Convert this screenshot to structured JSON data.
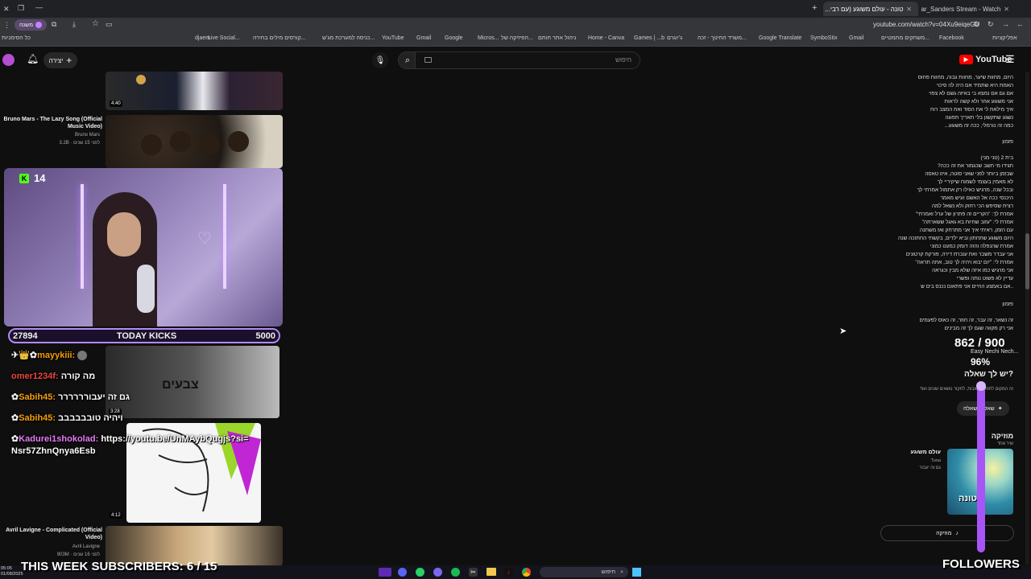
{
  "browser": {
    "tabs": [
      {
        "title": "טונה - עולם משוגע (עם רבי...",
        "active": true
      },
      {
        "title": "Hadar_Sanders Stream - Watch",
        "active": false
      }
    ],
    "url": "youtube.com/watch?v=04Xu9eiqeGU",
    "profile_label": "משנה",
    "bookmarks": [
      "כל הסימניות",
      "אפליקציות",
      "Facebook",
      "משחקים מתמטיים...",
      "Gmail",
      "SymboStix",
      "Google Translate",
      "משרד החינוך - זכה...",
      "ג'יוגרם",
      "Games | ...b",
      "Home - Canva",
      "ניהול אתר חותם",
      "הפיזיקה של...",
      "Micros...",
      "Google",
      "Gmail",
      "YouTube",
      "כניסה למערכת מג'ש...",
      "קורסים מילים בחירה...",
      "Live Social...",
      "djaem"
    ]
  },
  "yt_header": {
    "logo_text": "YouTube",
    "search_placeholder": "חיפוש",
    "create_label": "יצירה"
  },
  "recommendations": [
    {
      "duration": "4:40"
    },
    {
      "title": "Bruno Mars - The Lazy Song (Official Music Video)",
      "channel": "Bruno Mars",
      "meta": "3.2B · לפני 15 שנים"
    },
    {
      "title": "",
      "channel": "",
      "meta": "",
      "overlay_text": "צבעים",
      "duration": "3:28"
    },
    {
      "duration": "4:12"
    },
    {
      "title": "Avril Lavigne - Complicated (Official Video)",
      "channel": "Avril Lavigne",
      "meta": "903M · לפני 16 שנים"
    }
  ],
  "stream": {
    "kick_count": "14",
    "kicks_left": "27894",
    "kicks_label": "TODAY KICKS",
    "kicks_goal": "5000",
    "subs_goal": "THIS WEEK SUBSCRIBERS: 6 / 15",
    "followers_label": "FOLLOWERS",
    "colors": {
      "kick_green": "#53fc18",
      "accent_purple": "#a855f7"
    }
  },
  "chat": [
    {
      "user": "mayykiii:",
      "msg": "",
      "color": "#f59e0b"
    },
    {
      "user": "omer1234f:",
      "msg": "מה קורה",
      "color": "#ef4444"
    },
    {
      "user": "Sabih45:",
      "msg": "גם זה יעבורררררר",
      "color": "#f59e0b"
    },
    {
      "user": "Sabih45:",
      "msg": "ויהיה טובבבבבב",
      "color": "#f59e0b"
    },
    {
      "user": "Kadurei1shokolad:",
      "msg": "https://youtu.be/UnMAybQugjs?si=Nsr57ZhnQnya6Esb",
      "color": "#e879f9"
    }
  ],
  "lyrics": {
    "verse1": [
      "היום, מחוות שיער, מחוות גבוה, מחוות פחוס",
      "האמת היא שתמיד אם היה לה סיכוי",
      "אם גם אם נמצא בי באיזה גשם לא צפוי",
      "אני משוגע אחר ולא קשה לראות",
      "איך מילאת לי את הסוד ואת המצב רוח",
      "נשגע שתקשון בלי תאריך תפוגה",
      "כמה זה נורמלי, ככה זה משוגע..."
    ],
    "chorus_label_1": "פזמון",
    "verse2": [
      "בית 2 (טני מני)",
      "תגידו מי חשב שכגמור את זה ככה?",
      "שבזמן ביותר לפני שאני סוטה, איזו טאסה",
      "לא מאמין בעצמי לשמוח שיקיריי לך",
      "ובכל שנה, מרגיש כאילו רק אתמול אמרתי לך",
      "היכנסי ככה אל האשם ועיש מאמר",
      "רצית שסיפש הכי רחוק ולא נשאל למה",
      "אמרת לך: \"הקריים זה פתרון של ערל ואמרתי\"",
      "אמרת לי: \"עזוב שחיות בא גאגל ששארתה\"",
      "עם הזמן, ראיתי איך אני מתרחק ואז משתנה",
      "היום משוגע שתחתון וביא ילדים, בקשתי החתוכה שנה",
      "אמרת שהנפלה והזה דומק כמעט כמוני",
      "אני עבדר משבר ואת עוברת דירה, פורקת קרטונים",
      "אמרת לי: \"יום יבוא ויהיה לך טוב, אתה תראה\"",
      "אני מרגיש כמו איזה שלא מבין וכגראה",
      "עדיין לא פשוט נותה ופשרי",
      "..אם באמצע החיים אני פתאום נכנס בים ש"
    ],
    "chorus_label_2": "פזמון",
    "verse3": [
      "זה נשאר, זה עבר, זה חוזר, זה כאוס לפעמים",
      "אני רק מקווה שגם לך זה מבינים"
    ]
  },
  "engagement": {
    "likes": "862 / 900",
    "sub": "Easy Nechi Nech...",
    "percent": "96%"
  },
  "side_panel": {
    "question": "יש לך שאלה?",
    "question_sub": "זה המקום לחפש תשובות, לחקור נושאים שונים ועוד",
    "ask_button": "שאל/ה שאלה",
    "music_heading": "מוזיקה",
    "music_sub": "שיר אחד",
    "song_title": "עולם משוגע",
    "song_artist": "Tuna",
    "song_album": "גם זה יעבור",
    "album_label": "טונה",
    "music_button": "מוזיקה"
  },
  "taskbar": {
    "time": "05:05",
    "date": "01/08/2025",
    "search_label": "חיפוש"
  }
}
